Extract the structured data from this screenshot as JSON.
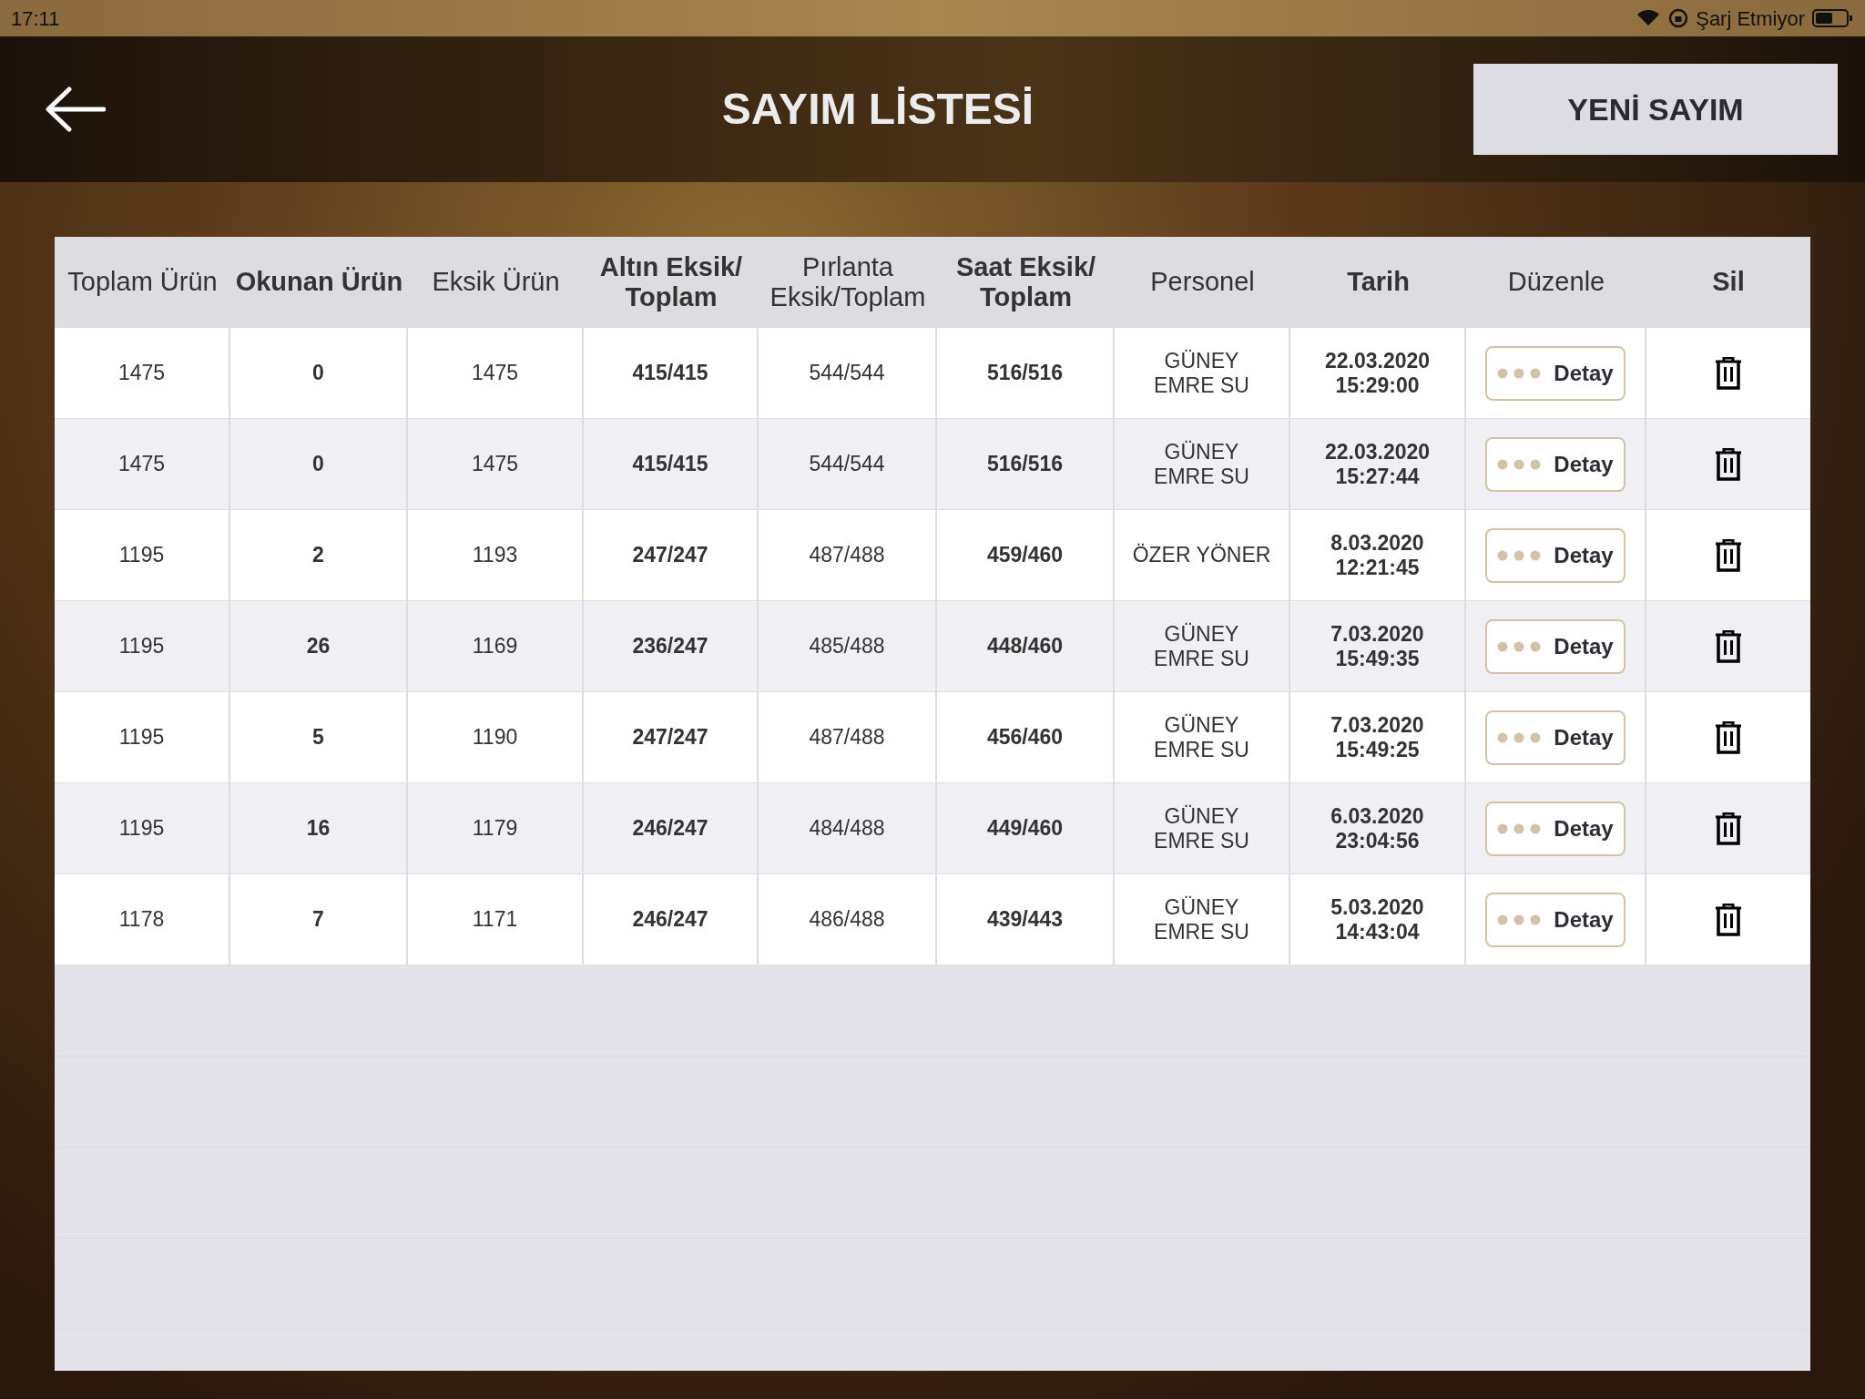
{
  "status_bar": {
    "time": "17:11",
    "charging": "Şarj Etmiyor"
  },
  "header": {
    "title": "SAYIM LİSTESİ",
    "new_button": "YENİ SAYIM"
  },
  "table": {
    "columns": [
      {
        "label": "Toplam Ürün",
        "bold": false
      },
      {
        "label": "Okunan Ürün",
        "bold": true
      },
      {
        "label": "Eksik Ürün",
        "bold": false
      },
      {
        "label": "Altın Eksik/\nToplam",
        "bold": true
      },
      {
        "label": "Pırlanta\nEksik/Toplam",
        "bold": false
      },
      {
        "label": "Saat Eksik/\nToplam",
        "bold": true
      },
      {
        "label": "Personel",
        "bold": false
      },
      {
        "label": "Tarih",
        "bold": true
      },
      {
        "label": "Düzenle",
        "bold": false
      },
      {
        "label": "Sil",
        "bold": true
      }
    ],
    "rows": [
      {
        "cells": [
          "1475",
          "0",
          "1475",
          "415/415",
          "544/544",
          "516/516",
          "GÜNEY\nEMRE SU",
          "22.03.2020\n15:29:00"
        ],
        "detail": "Detay"
      },
      {
        "cells": [
          "1475",
          "0",
          "1475",
          "415/415",
          "544/544",
          "516/516",
          "GÜNEY\nEMRE SU",
          "22.03.2020\n15:27:44"
        ],
        "detail": "Detay"
      },
      {
        "cells": [
          "1195",
          "2",
          "1193",
          "247/247",
          "487/488",
          "459/460",
          "ÖZER YÖNER",
          "8.03.2020\n12:21:45"
        ],
        "detail": "Detay"
      },
      {
        "cells": [
          "1195",
          "26",
          "1169",
          "236/247",
          "485/488",
          "448/460",
          "GÜNEY\nEMRE SU",
          "7.03.2020\n15:49:35"
        ],
        "detail": "Detay"
      },
      {
        "cells": [
          "1195",
          "5",
          "1190",
          "247/247",
          "487/488",
          "456/460",
          "GÜNEY\nEMRE SU",
          "7.03.2020\n15:49:25"
        ],
        "detail": "Detay"
      },
      {
        "cells": [
          "1195",
          "16",
          "1179",
          "246/247",
          "484/488",
          "449/460",
          "GÜNEY\nEMRE SU",
          "6.03.2020\n23:04:56"
        ],
        "detail": "Detay"
      },
      {
        "cells": [
          "1178",
          "7",
          "1171",
          "246/247",
          "486/488",
          "439/443",
          "GÜNEY\nEMRE SU",
          "5.03.2020\n14:43:04"
        ],
        "detail": "Detay"
      }
    ]
  }
}
